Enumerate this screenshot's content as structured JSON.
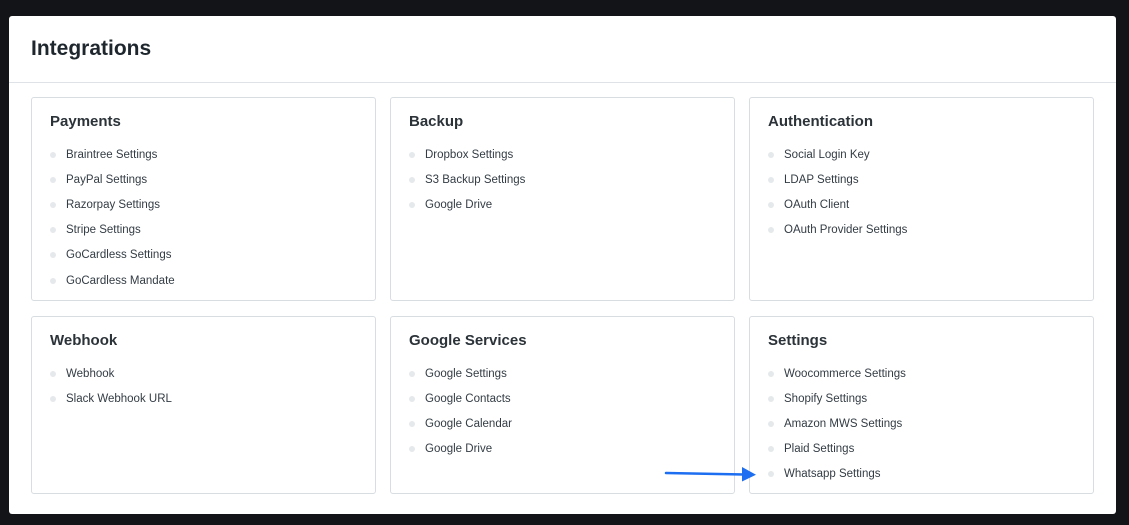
{
  "page": {
    "title": "Integrations"
  },
  "colors": {
    "background": "#121417",
    "panel": "#ffffff",
    "card_border": "#d8dde2",
    "arrow": "#1d6ef0"
  },
  "cards": [
    {
      "title": "Payments",
      "items": [
        "Braintree Settings",
        "PayPal Settings",
        "Razorpay Settings",
        "Stripe Settings",
        "GoCardless Settings",
        "GoCardless Mandate"
      ]
    },
    {
      "title": "Backup",
      "items": [
        "Dropbox Settings",
        "S3 Backup Settings",
        "Google Drive"
      ]
    },
    {
      "title": "Authentication",
      "items": [
        "Social Login Key",
        "LDAP Settings",
        "OAuth Client",
        "OAuth Provider Settings"
      ]
    },
    {
      "title": "Webhook",
      "items": [
        "Webhook",
        "Slack Webhook URL"
      ]
    },
    {
      "title": "Google Services",
      "items": [
        "Google Settings",
        "Google Contacts",
        "Google Calendar",
        "Google Drive"
      ]
    },
    {
      "title": "Settings",
      "items": [
        "Woocommerce Settings",
        "Shopify Settings",
        "Amazon MWS Settings",
        "Plaid Settings",
        "Whatsapp Settings"
      ]
    }
  ]
}
